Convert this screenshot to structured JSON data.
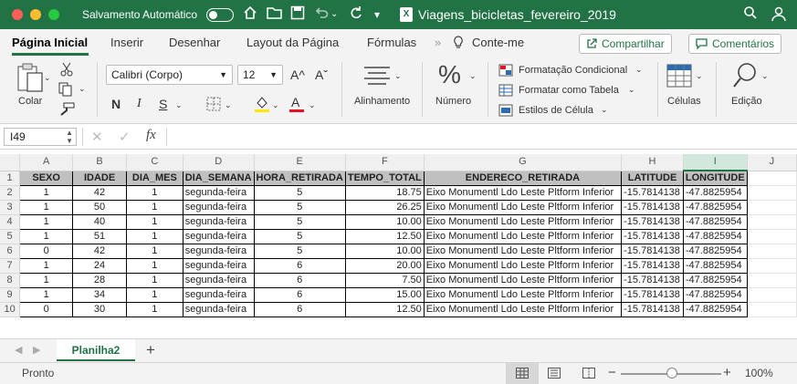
{
  "titlebar": {
    "autosave_label": "Salvamento Automático",
    "autosave_state": "off",
    "document_title": "Viagens_bicicletas_fevereiro_2019",
    "app_icon_letter": "X",
    "accent": "#217346"
  },
  "tabs": [
    "Página Inicial",
    "Inserir",
    "Desenhar",
    "Layout da Página",
    "Fórmulas",
    "Conte-me"
  ],
  "share_label": "Compartilhar",
  "comments_label": "Comentários",
  "ribbon": {
    "paste_label": "Colar",
    "font_name": "Calibri (Corpo)",
    "font_size": "12",
    "grow_font": "A^",
    "shrink_font": "Aˇ",
    "bold": "N",
    "italic": "I",
    "underline": "S",
    "alignment_label": "Alinhamento",
    "number_label": "Número",
    "conditional_format": "Formatação Condicional",
    "format_table": "Formatar como Tabela",
    "cell_styles": "Estilos de Célula",
    "cells_label": "Células",
    "edit_label": "Edição"
  },
  "formula_bar": {
    "name_box": "I49",
    "fx": "fx",
    "content": ""
  },
  "columns": [
    "A",
    "B",
    "C",
    "D",
    "E",
    "F",
    "G",
    "H",
    "I",
    "J"
  ],
  "selected_column": "I",
  "headers": [
    "SEXO",
    "IDADE",
    "DIA_MES",
    "DIA_SEMANA",
    "HORA_RETIRADA",
    "TEMPO_TOTAL",
    "ENDERECO_RETIRADA",
    "LATITUDE",
    "LONGITUDE"
  ],
  "rows": [
    [
      "1",
      "42",
      "1",
      "segunda-feira",
      "5",
      "18.75",
      "Eixo Monumentl Ldo Leste Pltform Inferior",
      "-15.7814138",
      "-47.8825954"
    ],
    [
      "1",
      "50",
      "1",
      "segunda-feira",
      "5",
      "26.25",
      "Eixo Monumentl Ldo Leste Pltform Inferior",
      "-15.7814138",
      "-47.8825954"
    ],
    [
      "1",
      "40",
      "1",
      "segunda-feira",
      "5",
      "10.00",
      "Eixo Monumentl Ldo Leste Pltform Inferior",
      "-15.7814138",
      "-47.8825954"
    ],
    [
      "1",
      "51",
      "1",
      "segunda-feira",
      "5",
      "12.50",
      "Eixo Monumentl Ldo Leste Pltform Inferior",
      "-15.7814138",
      "-47.8825954"
    ],
    [
      "0",
      "42",
      "1",
      "segunda-feira",
      "5",
      "10.00",
      "Eixo Monumentl Ldo Leste Pltform Inferior",
      "-15.7814138",
      "-47.8825954"
    ],
    [
      "1",
      "24",
      "1",
      "segunda-feira",
      "6",
      "20.00",
      "Eixo Monumentl Ldo Leste Pltform Inferior",
      "-15.7814138",
      "-47.8825954"
    ],
    [
      "1",
      "28",
      "1",
      "segunda-feira",
      "6",
      "7.50",
      "Eixo Monumentl Ldo Leste Pltform Inferior",
      "-15.7814138",
      "-47.8825954"
    ],
    [
      "1",
      "34",
      "1",
      "segunda-feira",
      "6",
      "15.00",
      "Eixo Monumentl Ldo Leste Pltform Inferior",
      "-15.7814138",
      "-47.8825954"
    ],
    [
      "0",
      "30",
      "1",
      "segunda-feira",
      "6",
      "12.50",
      "Eixo Monumentl Ldo Leste Pltform Inferior",
      "-15.7814138",
      "-47.8825954"
    ]
  ],
  "row_numbers": [
    "1",
    "2",
    "3",
    "4",
    "5",
    "6",
    "7",
    "8",
    "9",
    "10"
  ],
  "sheet_tab": "Planilha2",
  "add_sheet": "+",
  "status": {
    "ready": "Pronto",
    "zoom": "100%",
    "zoom_minus": "−",
    "zoom_plus": "+"
  }
}
